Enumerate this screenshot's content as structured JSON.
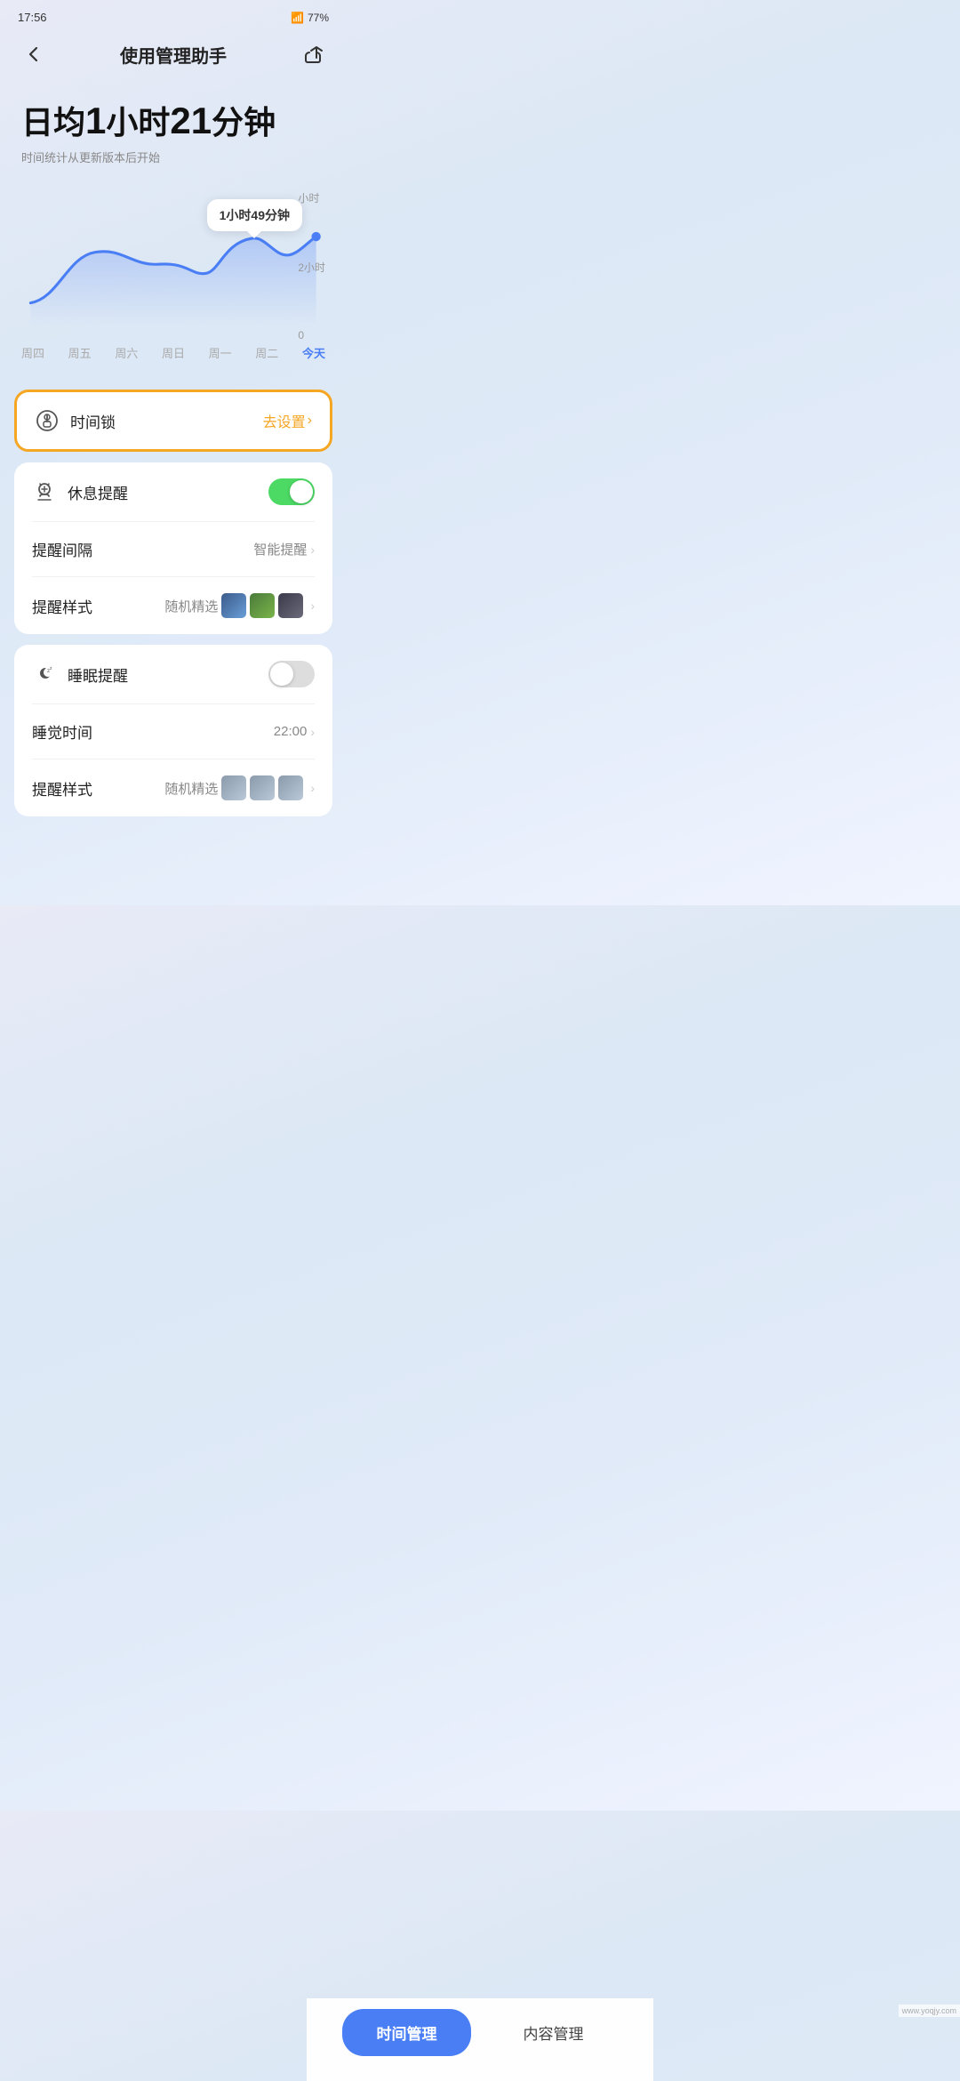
{
  "statusBar": {
    "time": "17:56",
    "battery": "77%"
  },
  "header": {
    "title": "使用管理助手",
    "backLabel": "‹",
    "shareLabel": "↪"
  },
  "dailyAvg": {
    "title": "日均",
    "num1": "1",
    "unit1": "小时",
    "num2": "21",
    "unit2": "分钟",
    "subtitle": "时间统计从更新版本后开始"
  },
  "chart": {
    "tooltip": "1小时49分钟",
    "yLabels": [
      "小时",
      "2小时",
      "0"
    ],
    "xLabels": [
      "周四",
      "周五",
      "周六",
      "周日",
      "周一",
      "周二",
      "今天"
    ]
  },
  "timeLock": {
    "label": "时间锁",
    "actionLabel": "去设置",
    "chevron": "›"
  },
  "restReminder": {
    "label": "休息提醒",
    "enabled": true
  },
  "reminderInterval": {
    "label": "提醒间隔",
    "value": "智能提醒",
    "chevron": "›"
  },
  "reminderStyle": {
    "label": "提醒样式",
    "value": "随机精选",
    "chevron": "›"
  },
  "sleepReminder": {
    "label": "睡眠提醒",
    "enabled": false
  },
  "sleepTime": {
    "label": "睡觉时间",
    "value": "22:00",
    "chevron": "›"
  },
  "sleepReminderStyle": {
    "label": "提醒样式",
    "value": "随机精选",
    "chevron": "›"
  },
  "bottomNav": {
    "timeManagement": "时间管理",
    "contentManagement": "内容管理"
  },
  "watermark": "www.yoqjy.com"
}
